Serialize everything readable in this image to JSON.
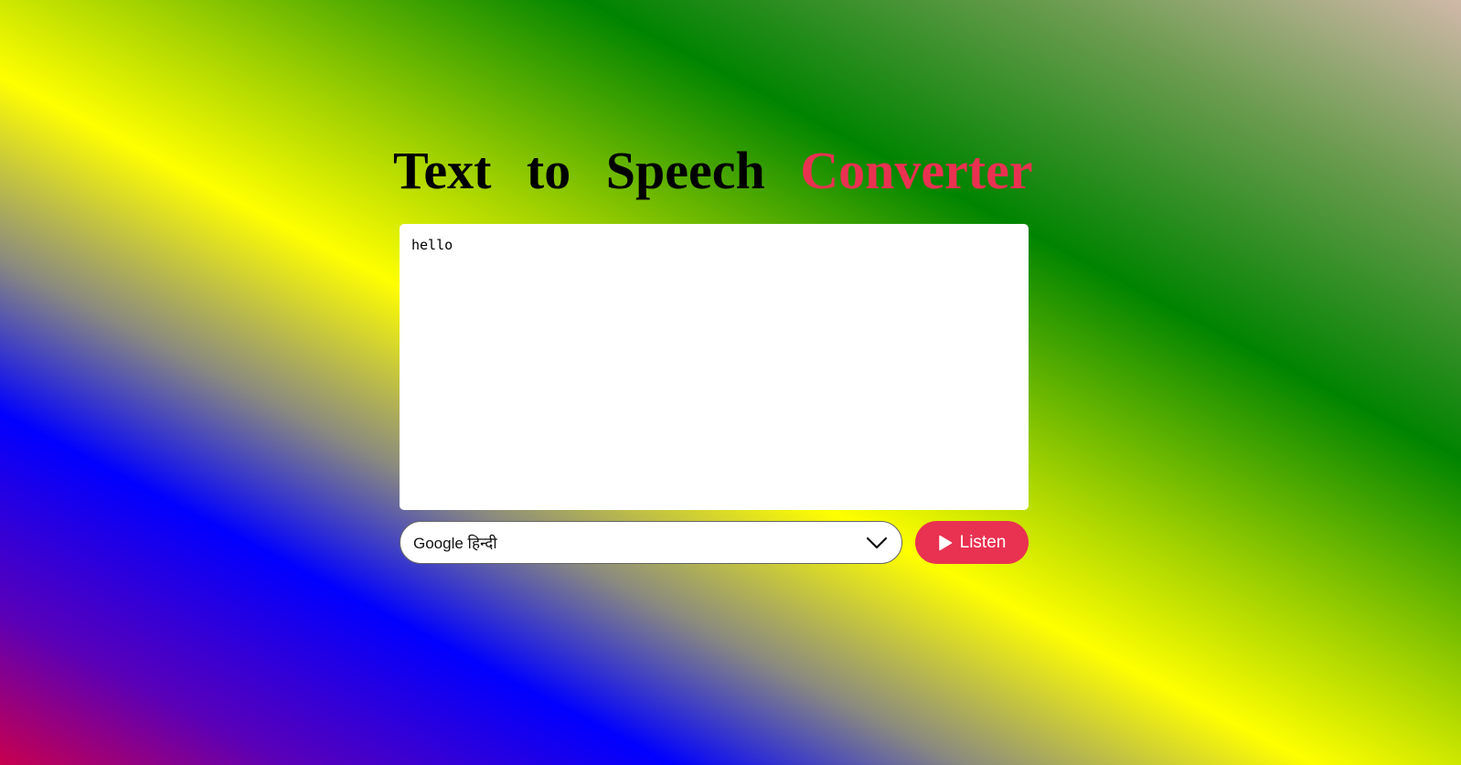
{
  "header": {
    "title_main": "Text to Speech",
    "title_accent": "Converter"
  },
  "editor": {
    "value": "hello"
  },
  "voice_select": {
    "selected": "Google हिन्दी",
    "icon": "chevron-down-icon"
  },
  "listen_button": {
    "label": "Listen",
    "icon": "play-icon"
  },
  "colors": {
    "accent": "#e93151",
    "panel": "#ffffff"
  }
}
